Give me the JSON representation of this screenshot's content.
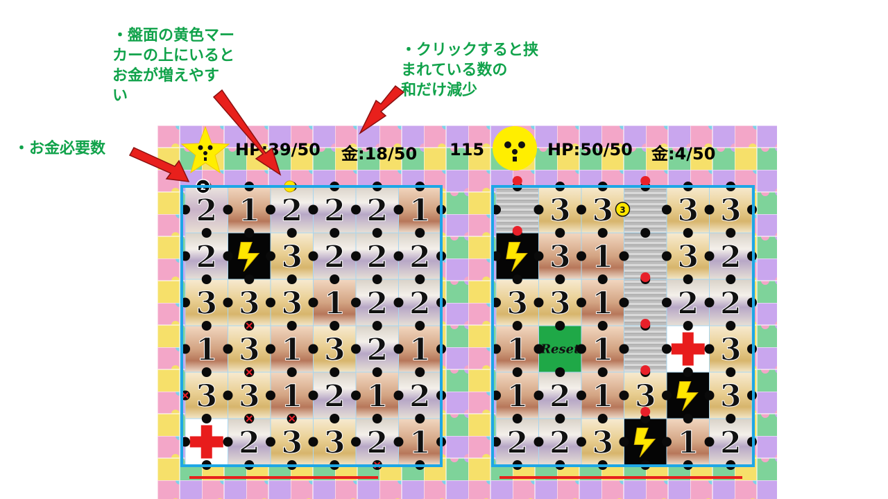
{
  "notes": {
    "money_required": "・お金必要数",
    "yellow_marker": "・盤面の黄色マー\nカーの上にいると\nお金が増えやす\nい",
    "click_effect": "・クリックすると挟\nまれている数の\n和だけ減少"
  },
  "player": {
    "hp_text": "HP:39/50",
    "money_text": "金:18/50",
    "face": "star-face"
  },
  "timer": "115",
  "enemy": {
    "hp_text": "HP:50/50",
    "money_text": "金:4/50",
    "face": "sun-face"
  },
  "left_board": {
    "money_required_badge": "2",
    "grid": [
      [
        "2",
        "1",
        "2",
        "2",
        "2",
        "1"
      ],
      [
        "2",
        "bolt",
        "3",
        "2",
        "2",
        "2"
      ],
      [
        "3",
        "3",
        "3",
        "1",
        "2",
        "2"
      ],
      [
        "1",
        "3",
        "1",
        "3",
        "2",
        "1"
      ],
      [
        "3",
        "3",
        "1",
        "2",
        "1",
        "2"
      ],
      [
        "heal",
        "2",
        "3",
        "3",
        "2",
        "1"
      ]
    ],
    "tile_tones": [
      [
        "p",
        "t",
        "s",
        "s",
        "s",
        "t"
      ],
      [
        "s",
        "k",
        "y",
        "s",
        "s",
        "s"
      ],
      [
        "y",
        "y",
        "y",
        "t",
        "s",
        "s"
      ],
      [
        "t",
        "y",
        "t",
        "y",
        "s",
        "t"
      ],
      [
        "y",
        "y",
        "t",
        "s",
        "t",
        "s"
      ],
      [
        "w",
        "s",
        "y",
        "y",
        "s",
        "t"
      ]
    ]
  },
  "right_board": {
    "enemy_badge": "3",
    "reset_label": "Reset",
    "grid": [
      [
        "wall",
        "3",
        "3",
        "wall",
        "3",
        "3"
      ],
      [
        "bolt",
        "3",
        "1",
        "wall",
        "3",
        "2"
      ],
      [
        "3",
        "3",
        "1",
        "wall",
        "2",
        "2"
      ],
      [
        "1",
        "reset",
        "1",
        "wall",
        "heal",
        "3"
      ],
      [
        "1",
        "2",
        "1",
        "3",
        "bolt",
        "3"
      ],
      [
        "2",
        "2",
        "3",
        "bolt",
        "1",
        "2"
      ]
    ],
    "tile_tones": [
      [
        "g",
        "y",
        "y",
        "g",
        "y",
        "y"
      ],
      [
        "k",
        "t",
        "t",
        "g",
        "y",
        "s"
      ],
      [
        "y",
        "y",
        "t",
        "g",
        "s",
        "s"
      ],
      [
        "t",
        "r",
        "t",
        "g",
        "w",
        "y"
      ],
      [
        "t",
        "s",
        "t",
        "y",
        "k",
        "y"
      ],
      [
        "s",
        "s",
        "y",
        "k",
        "t",
        "s"
      ]
    ]
  },
  "colors": {
    "frame": "#1ea7e6",
    "note_green": "#10a24a",
    "arrow_red": "#e8201c",
    "marker_yellow": "#ffe600",
    "marker_red": "#e8202a",
    "reset_green": "#1fa847",
    "heal_red": "#e81c1c"
  }
}
